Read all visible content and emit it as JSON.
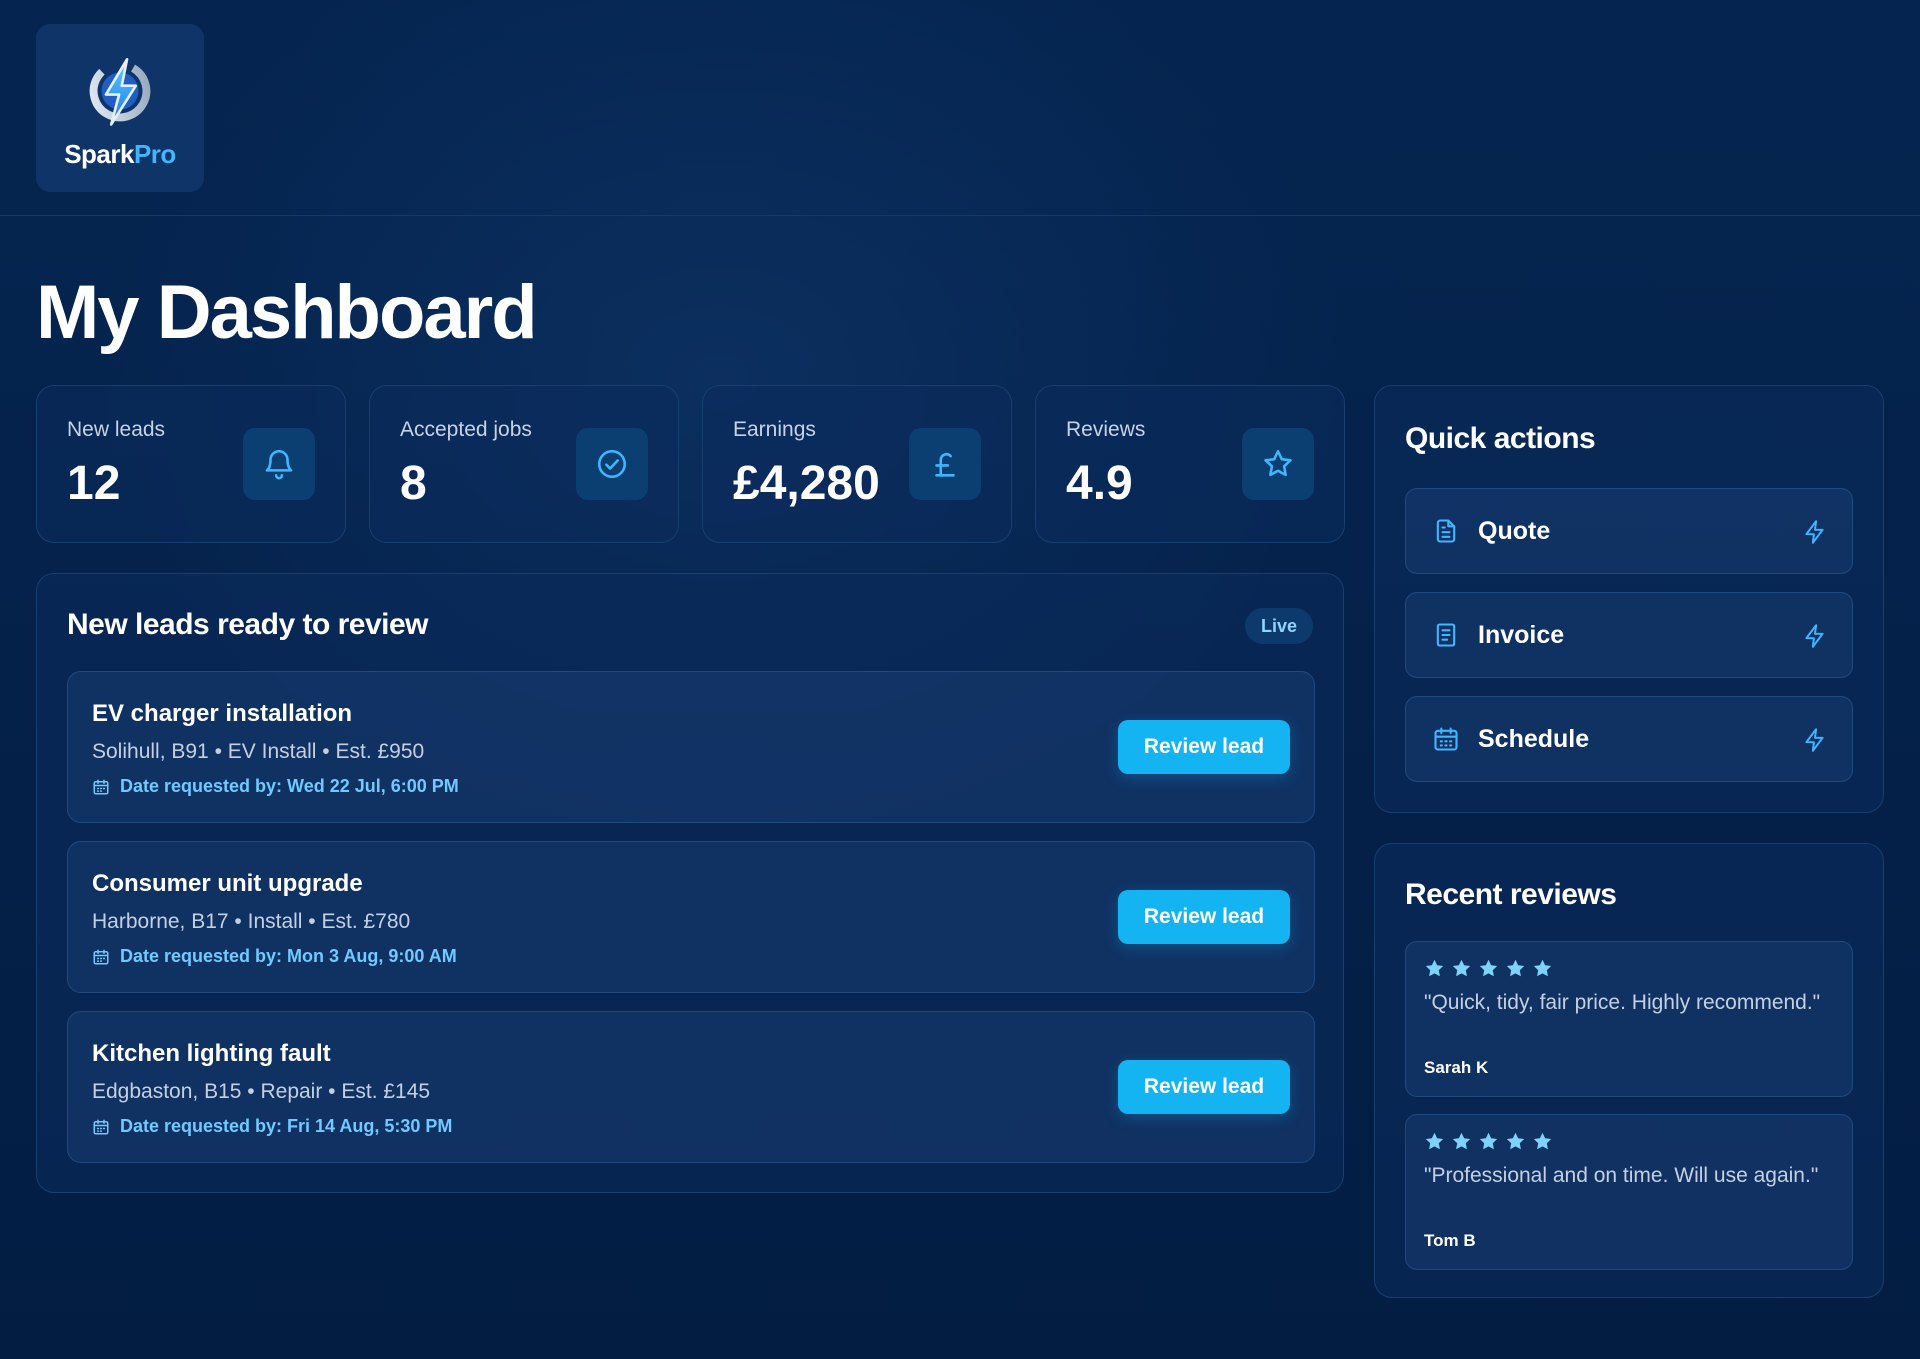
{
  "brand": {
    "name_part1": "Spark",
    "name_part2": "Pro",
    "logo_icon": "lightning-bolt-icon",
    "accent_color": "#3fb7ff"
  },
  "page": {
    "title": "My Dashboard"
  },
  "stats": [
    {
      "label": "New leads",
      "value": "12",
      "icon": "bell-icon"
    },
    {
      "label": "Accepted jobs",
      "value": "8",
      "icon": "check-circle-icon"
    },
    {
      "label": "Earnings",
      "value": "£4,280",
      "icon": "pound-icon"
    },
    {
      "label": "Reviews",
      "value": "4.9",
      "icon": "star-icon"
    }
  ],
  "leads": {
    "title": "New leads ready to review",
    "badge": "Live",
    "items": [
      {
        "title": "EV charger installation",
        "meta": "Solihull, B91 • EV Install • Est. £950",
        "date": "Date requested by: Wed 22 Jul, 6:00 PM",
        "button": "Review lead"
      },
      {
        "title": "Consumer unit upgrade",
        "meta": "Harborne, B17 • Install • Est. £780",
        "date": "Date requested by: Mon 3 Aug, 9:00 AM",
        "button": "Review lead"
      },
      {
        "title": "Kitchen lighting fault",
        "meta": "Edgbaston, B15 • Repair • Est. £145",
        "date": "Date requested by: Fri 14 Aug, 5:30 PM",
        "button": "Review lead"
      }
    ]
  },
  "quick_actions": {
    "title": "Quick actions",
    "items": [
      {
        "label": "Quote",
        "icon": "document-icon"
      },
      {
        "label": "Invoice",
        "icon": "receipt-icon"
      },
      {
        "label": "Schedule",
        "icon": "calendar-icon"
      }
    ]
  },
  "reviews": {
    "title": "Recent reviews",
    "items": [
      {
        "rating": 5,
        "text": "\"Quick, tidy, fair price. Highly recommend.\"",
        "author": "Sarah K"
      },
      {
        "rating": 5,
        "text": "\"Professional and on time. Will use again.\"",
        "author": "Tom B"
      }
    ]
  },
  "colors": {
    "background": "#03214a",
    "card": "#0b2c5c",
    "button": "#14b4f2",
    "date_text": "#6fcaff",
    "star": "#7dd3fc"
  }
}
